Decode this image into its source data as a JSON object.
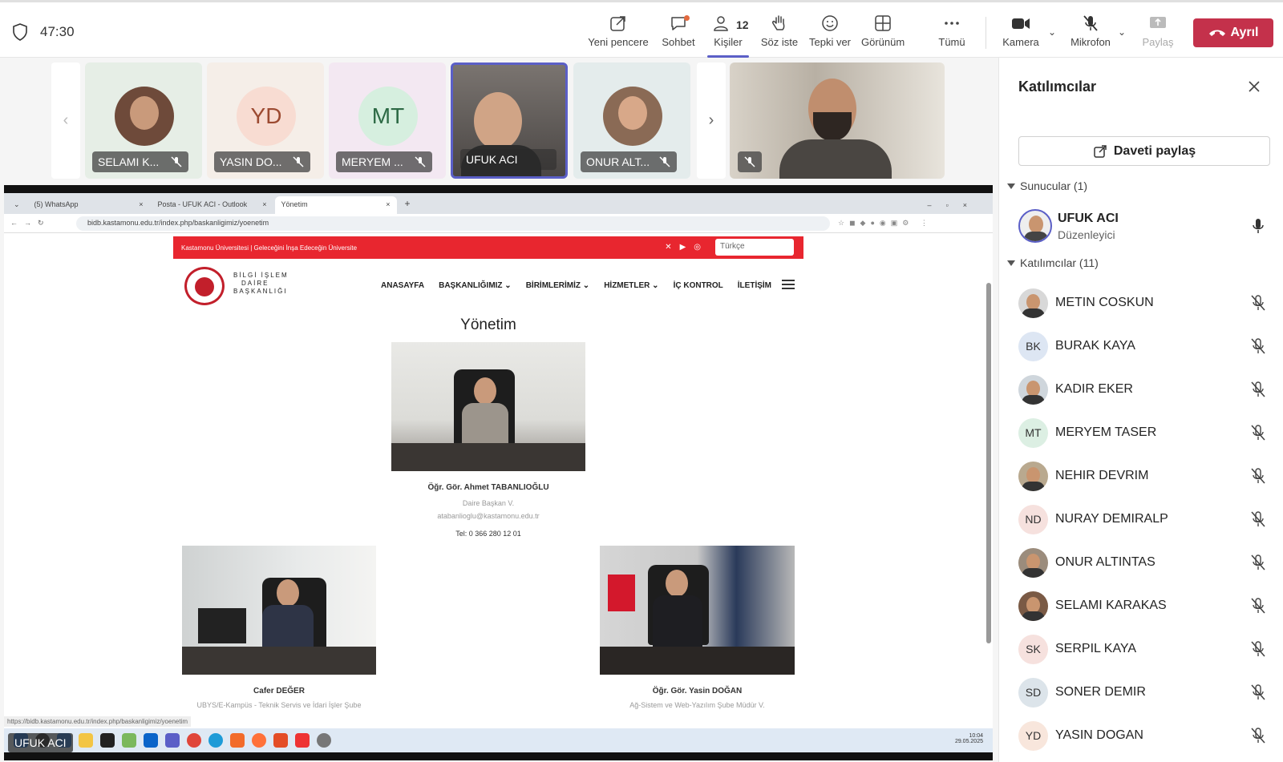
{
  "meeting": {
    "timer": "47:30",
    "toolbar": {
      "new_window": "Yeni pencere",
      "chat": "Sohbet",
      "people": "Kişiler",
      "people_count": "12",
      "raise_hand": "Söz iste",
      "react": "Tepki ver",
      "view": "Görünüm",
      "more": "Tümü",
      "camera": "Kamera",
      "mic": "Mikrofon",
      "share": "Paylaş",
      "leave": "Ayrıl"
    },
    "accent": "#5b5fc7",
    "leave_color": "#c4314b"
  },
  "tiles": [
    {
      "name": "SELAMI K...",
      "initials": "",
      "bg": "#e6eee6",
      "muted": true
    },
    {
      "name": "YASIN DO...",
      "initials": "YD",
      "bg": "#f6eee8",
      "muted": true
    },
    {
      "name": "MERYEM ...",
      "initials": "MT",
      "bg": "#f2e8f2",
      "muted": true
    },
    {
      "name": "UFUK ACI",
      "initials": "",
      "bg": "#6b6b6b",
      "muted": false,
      "active": true
    },
    {
      "name": "ONUR ALT...",
      "initials": "",
      "bg": "#e4ecec",
      "muted": true
    }
  ],
  "shared_screen": {
    "presenter": "UFUK ACI",
    "tabs": [
      {
        "title": "(5) WhatsApp"
      },
      {
        "title": "Posta - UFUK ACI - Outlook"
      },
      {
        "title": "Yönetim"
      }
    ],
    "url": "bidb.kastamonu.edu.tr/index.php/baskanligimiz/yoenetim",
    "status_url": "https://bidb.kastamonu.edu.tr/index.php/baskanligimiz/yoenetim",
    "site": {
      "topbar_text": "Kastamonu Üniversitesi | Geleceğini İnşa Edeceğin Üniversite",
      "language": "Türkçe",
      "brand_line1": "BİLGİ İŞLEM",
      "brand_line2": "DAİRE",
      "brand_line3": "BAŞKANLIĞI",
      "menu": [
        "ANASAYFA",
        "BAŞKANLIĞIMIZ ⌄",
        "BİRİMLERİMİZ ⌄",
        "HİZMETLER ⌄",
        "İÇ KONTROL",
        "İLETİŞİM"
      ],
      "page_title": "Yönetim",
      "head": {
        "name": "Öğr. Gör. Ahmet TABANLIOĞLU",
        "role": "Daire Başkan V.",
        "email": "atabanlioglu@kastamonu.edu.tr",
        "phone": "Tel: 0 366 280 12 01"
      },
      "left_person": {
        "name": "Cafer DEĞER",
        "role": "UBYS/E-Kampüs - Teknik Servis ve İdari İşler Şube"
      },
      "right_person": {
        "name": "Öğr. Gör.  Yasin DOĞAN",
        "role": "Ağ-Sistem ve Web-Yazılım Şube Müdür V."
      }
    },
    "taskbar_time": "10:04",
    "taskbar_date": "29.05.2025"
  },
  "panel": {
    "title": "Katılımcılar",
    "invite": "Daveti paylaş",
    "presenters_header": "Sunucular (1)",
    "presenter": {
      "name": "UFUK ACI",
      "role": "Düzenleyici"
    },
    "participants_header": "Katılımcılar (11)",
    "participants": [
      {
        "name": "METIN COSKUN",
        "initials": "",
        "bg": "#d8d8d8",
        "photo": true
      },
      {
        "name": "BURAK KAYA",
        "initials": "BK",
        "bg": "#dde6f3"
      },
      {
        "name": "KADIR EKER",
        "initials": "",
        "bg": "#cfd6dc",
        "photo": true
      },
      {
        "name": "MERYEM TASER",
        "initials": "MT",
        "bg": "#dcefe3"
      },
      {
        "name": "NEHIR DEVRIM",
        "initials": "",
        "bg": "#b9a98f",
        "photo": true
      },
      {
        "name": "NURAY DEMIRALP",
        "initials": "ND",
        "bg": "#f6e1de"
      },
      {
        "name": "ONUR ALTINTAS",
        "initials": "",
        "bg": "#9b8c7c",
        "photo": true
      },
      {
        "name": "SELAMI KARAKAS",
        "initials": "",
        "bg": "#7a5a45",
        "photo": true
      },
      {
        "name": "SERPIL KAYA",
        "initials": "SK",
        "bg": "#f6e1de"
      },
      {
        "name": "SONER DEMIR",
        "initials": "SD",
        "bg": "#dce4ea"
      },
      {
        "name": "YASIN DOGAN",
        "initials": "YD",
        "bg": "#f8e6dc"
      }
    ]
  }
}
